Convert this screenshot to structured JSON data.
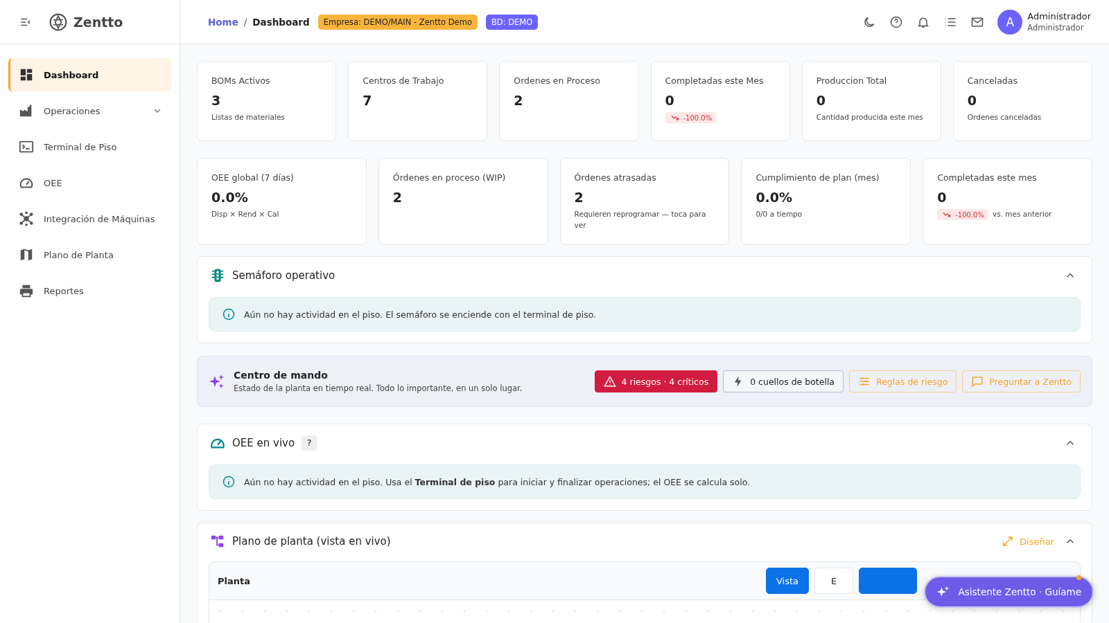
{
  "brand": {
    "name": "Zentto"
  },
  "sidebar": {
    "items": [
      {
        "label": "Dashboard",
        "selected": true
      },
      {
        "label": "Operaciones",
        "selected": false,
        "expanded": false
      },
      {
        "label": "Terminal de Piso",
        "selected": false
      },
      {
        "label": "OEE",
        "selected": false
      },
      {
        "label": "Integración de Máquinas",
        "selected": false
      },
      {
        "label": "Plano de Planta",
        "selected": false
      },
      {
        "label": "Reportes",
        "selected": false
      }
    ]
  },
  "header": {
    "breadcrumb": [
      "Home",
      "Dashboard"
    ],
    "separator": "/",
    "badges": [
      {
        "text": "Empresa: DEMO/MAIN - Zentto Demo",
        "kind": "company"
      },
      {
        "text": "BD: DEMO",
        "kind": "db"
      }
    ],
    "user": {
      "initial": "A",
      "name": "Administrador",
      "role": "Administrador"
    }
  },
  "stats": [
    {
      "label": "BOMs Activos",
      "value": "3",
      "sub": "Listas de materiales"
    },
    {
      "label": "Centros de Trabajo",
      "value": "7"
    },
    {
      "label": "Ordenes en Proceso",
      "value": "2"
    },
    {
      "label": "Completadas este Mes",
      "value": "0",
      "trend": "-100.0%"
    },
    {
      "label": "Produccion Total",
      "value": "0",
      "sub": "Cantidad producida este mes"
    },
    {
      "label": "Canceladas",
      "value": "0",
      "sub": "Ordenes canceladas"
    }
  ],
  "kpis": [
    {
      "label": "OEE global (7 días)",
      "value": "0.0%",
      "sub": "Disp × Rend × Cal"
    },
    {
      "label": "Órdenes en proceso (WIP)",
      "value": "2"
    },
    {
      "label": "Órdenes atrasadas",
      "value": "2",
      "sub": "Requieren reprogramar — toca para ver"
    },
    {
      "label": "Cumplimiento de plan (mes)",
      "value": "0.0%",
      "sub": "0/0 a tiempo"
    },
    {
      "label": "Completadas este mes",
      "value": "0",
      "trend": "-100.0%",
      "sub": "vs. mes anterior"
    }
  ],
  "semaforo": {
    "title": "Semáforo operativo",
    "expanded": true,
    "info": "Aún no hay actividad en el piso. El semáforo se enciende con el terminal de piso."
  },
  "command": {
    "title": "Centro de mando",
    "subtitle": "Estado de la planta en tiempo real. Todo lo importante, en un solo lugar.",
    "actions": [
      {
        "label": "4 riesgos · 4 críticos",
        "kind": "danger"
      },
      {
        "label": "0 cuellos de botella",
        "kind": "neutral"
      },
      {
        "label": "Reglas de riesgo",
        "kind": "rules"
      },
      {
        "label": "Preguntar a Zentto",
        "kind": "ask"
      }
    ]
  },
  "oee_live": {
    "title": "OEE en vivo",
    "help": "?",
    "expanded": true,
    "info": "Aún no hay actividad en el piso. Usa el **Terminal de piso** para iniciar y finalizar operaciones; el OEE se calcula solo."
  },
  "floor_plan": {
    "title": "Plano de planta (vista en vivo)",
    "design": "Diseñar",
    "expanded": true,
    "panel_title": "Planta",
    "modes": [
      {
        "label": "Vista",
        "selected": true
      },
      {
        "label": "E",
        "selected": false
      },
      {
        "selected": true
      }
    ]
  },
  "assistant": {
    "label": "Asistente Zentto · Guíame",
    "notify": true
  }
}
